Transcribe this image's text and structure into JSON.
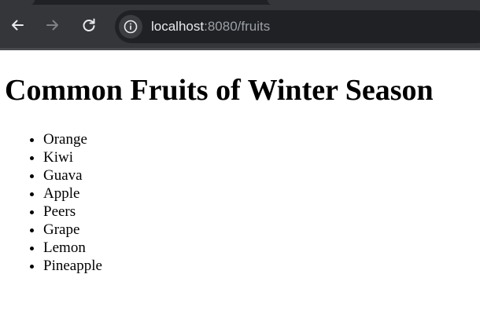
{
  "browser": {
    "address_bar": {
      "host": "localhost",
      "rest": ":8080/fruits"
    },
    "icons": {
      "back": "arrow-left",
      "forward": "arrow-right",
      "reload": "reload",
      "site_info": "info-circle"
    },
    "colors": {
      "chrome_bg": "#35363a",
      "omnibox_bg": "#202124",
      "host_text": "#e8eaed",
      "path_text": "#9aa0a6"
    }
  },
  "page": {
    "title": "Common Fruits of Winter Season",
    "fruits": [
      "Orange",
      "Kiwi",
      "Guava",
      "Apple",
      "Peers",
      "Grape",
      "Lemon",
      "Pineapple"
    ]
  }
}
